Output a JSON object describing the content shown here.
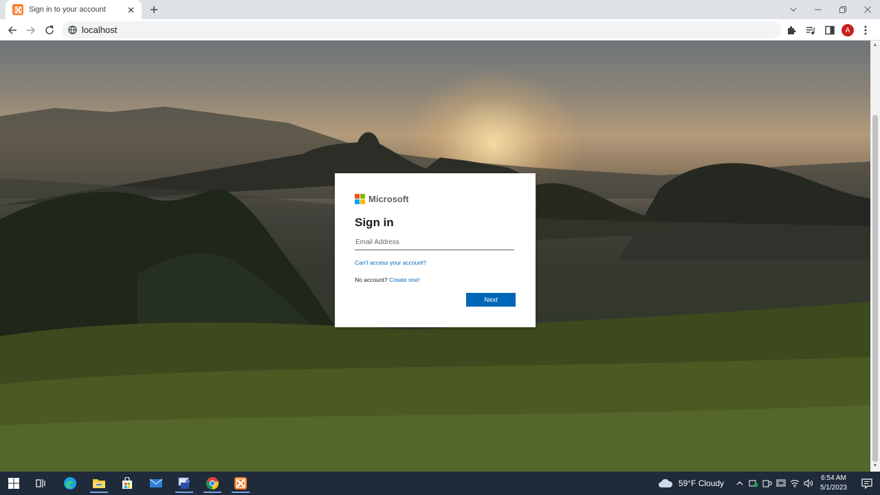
{
  "browser": {
    "tab_title": "Sign in to your account",
    "url": "localhost",
    "profile_initial": "A",
    "icons": {
      "tab_favicon": "xampp-icon",
      "tab_close": "close-icon",
      "new_tab": "plus-icon",
      "back": "back-arrow-icon",
      "forward": "forward-arrow-icon",
      "reload": "reload-icon",
      "site_info": "site-info-icon",
      "extensions": "puzzle-icon",
      "media": "media-playlist-icon",
      "side_panel": "side-panel-icon",
      "menu": "kebab-menu-icon"
    }
  },
  "signin": {
    "brand": "Microsoft",
    "heading": "Sign in",
    "email_placeholder": "Email Address",
    "email_value": "",
    "cant_access": "Can't access your account?",
    "no_account": "No account?",
    "create_one": "Create one!",
    "next_button": "Next",
    "colors": {
      "accent": "#0067b8",
      "logo_red": "#f25022",
      "logo_green": "#7fba00",
      "logo_blue": "#00a4ef",
      "logo_yellow": "#ffb900"
    }
  },
  "taskbar": {
    "weather": "59°F  Cloudy",
    "time": "6:54 AM",
    "date": "5/1/2023",
    "apps": [
      "start-icon",
      "task-view-icon",
      "edge-icon",
      "file-explorer-icon",
      "store-icon",
      "mail-icon",
      "app-icon",
      "chrome-icon",
      "xampp-icon"
    ]
  }
}
